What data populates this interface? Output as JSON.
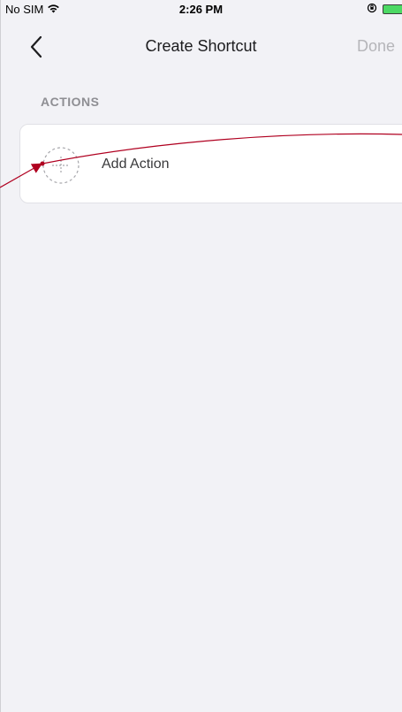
{
  "status_bar": {
    "carrier": "No SIM",
    "time": "2:26 PM",
    "icons": [
      "wifi-icon",
      "orientation-lock-icon",
      "battery-charging-icon"
    ]
  },
  "nav": {
    "title": "Create Shortcut",
    "done_label": "Done",
    "back_icon": "chevron-left-icon"
  },
  "section": {
    "header": "ACTIONS"
  },
  "action": {
    "label": "Add Action",
    "icon": "dashed-plus-circle-icon"
  },
  "colors": {
    "background": "#f2f2f6",
    "card": "#ffffff",
    "done_disabled": "#b5b5b9",
    "section_header": "#8e8e93",
    "annotation_arrow": "#b00020"
  }
}
